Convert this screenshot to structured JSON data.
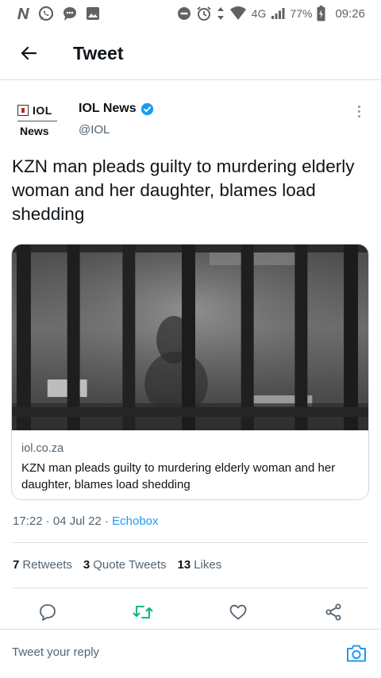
{
  "status_bar": {
    "network": "4G",
    "battery": "77%",
    "time": "09:26"
  },
  "header": {
    "title": "Tweet"
  },
  "author": {
    "logo_line1": "IOL",
    "logo_line2": "News",
    "name": "IOL News",
    "handle": "@IOL"
  },
  "tweet": {
    "text": "KZN man pleads guilty to murdering elderly woman and her daughter, blames load shedding",
    "card": {
      "domain": "iol.co.za",
      "title": "KZN man pleads guilty to murdering elderly woman and her daughter, blames load shedding"
    },
    "time": "17:22",
    "date": "04 Jul 22",
    "separator": "·",
    "source": "Echobox"
  },
  "stats": {
    "retweets_count": "7",
    "retweets_label": "Retweets",
    "quotes_count": "3",
    "quotes_label": "Quote Tweets",
    "likes_count": "13",
    "likes_label": "Likes"
  },
  "reply": {
    "placeholder": "Tweet your reply"
  },
  "colors": {
    "accent": "#1d9bf0",
    "retweet_green": "#00ba7c",
    "secondary_text": "#536471"
  },
  "icons": {
    "status_left": [
      "n-notification-icon",
      "whatsapp-icon",
      "chat-icon",
      "image-icon"
    ],
    "status_right": [
      "do-not-disturb-icon",
      "alarm-icon",
      "data-arrows-icon",
      "wifi-icon",
      "signal-icon",
      "battery-icon"
    ],
    "actions": [
      "reply-icon",
      "retweet-icon",
      "like-icon",
      "share-icon"
    ]
  }
}
